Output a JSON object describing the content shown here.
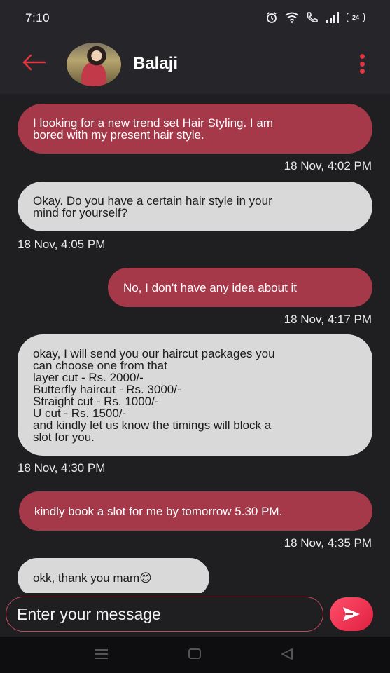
{
  "status_bar": {
    "time": "7:10",
    "battery": "24"
  },
  "header": {
    "contact_name": "Balaji"
  },
  "messages": [
    {
      "sender": "me",
      "text": "I looking for a new trend set Hair Styling. I am\nbored with my present hair style.",
      "time": "18 Nov, 4:02 PM"
    },
    {
      "sender": "them",
      "text": "Okay. Do you have a certain hair style in your\nmind for yourself?",
      "time": "18 Nov, 4:05 PM"
    },
    {
      "sender": "me",
      "text": "No, I don't have any idea about it",
      "time": "18 Nov, 4:17 PM"
    },
    {
      "sender": "them",
      "text": "okay, I will send you our haircut packages you\ncan choose one from that\nlayer cut - Rs. 2000/-\nButterfly haircut - Rs. 3000/-\nStraight cut - Rs. 1000/-\nU cut - Rs. 1500/-\nand kindly let us know the timings will block a\nslot for you.",
      "time": "18 Nov, 4:30 PM"
    },
    {
      "sender": "me",
      "text": "kindly book a slot for me by tomorrow 5.30 PM.",
      "time": "18 Nov, 4:35 PM"
    },
    {
      "sender": "them",
      "text": "okk, thank you mam😊",
      "time": ""
    }
  ],
  "input": {
    "placeholder": "Enter your message"
  },
  "colors": {
    "sent_bubble": "#a5394a",
    "received_bubble": "#d9d9d9",
    "accent": "#e0353f"
  },
  "icons": [
    "back-arrow-icon",
    "more-vert-icon",
    "send-icon",
    "alarm-icon",
    "wifi-icon",
    "call-icon",
    "signal-icon"
  ]
}
